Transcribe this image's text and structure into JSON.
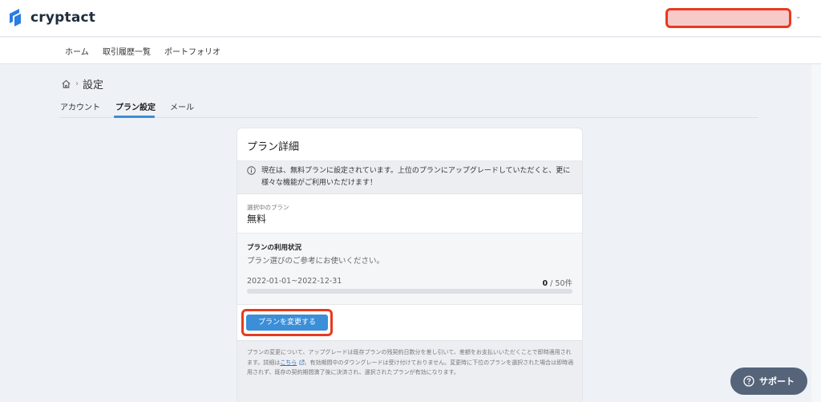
{
  "app": {
    "name": "cryptact",
    "brand_color": "#2a7de1"
  },
  "nav": {
    "items": [
      {
        "label": "ホーム"
      },
      {
        "label": "取引履歴一覧"
      },
      {
        "label": "ポートフォリオ"
      }
    ]
  },
  "breadcrumb": {
    "home_icon": "home-icon",
    "current": "設定"
  },
  "tabs": [
    {
      "label": "アカウント"
    },
    {
      "label": "プラン設定",
      "active": true
    },
    {
      "label": "メール"
    }
  ],
  "card": {
    "title": "プラン詳細",
    "notice": "現在は、無料プランに設定されています。上位のプランにアップグレードしていただくと、更に様々な機能がご利用いただけます！",
    "plan_label": "選択中のプラン",
    "plan_value": "無料",
    "usage_title": "プランの利用状況",
    "usage_sub": "プラン選びのご参考にお使いください。",
    "usage_period": "2022-01-01~2022-12-31",
    "usage_used": "0",
    "usage_limit": " / 50件",
    "usage_fraction": 0,
    "change_button": "プランを変更する",
    "footer_1": "プランの変更について、アップグレードは既存プランの残契約日数分を差し引いて、差額をお支払いいただくことで即時適用されます。詳細は",
    "footer_link": "こちら",
    "footer_2": "。有効期間中のダウングレードは受け付けておりません。変更時に下位のプランを選択された場合は即時適用されず、既存の契約期間満了後に決済され、選択されたプランが有効になります。"
  },
  "support": {
    "label": "サポート"
  },
  "colors": {
    "accent": "#3b8ed8",
    "highlight": "#e63b1f",
    "support_bg": "#56647a"
  }
}
